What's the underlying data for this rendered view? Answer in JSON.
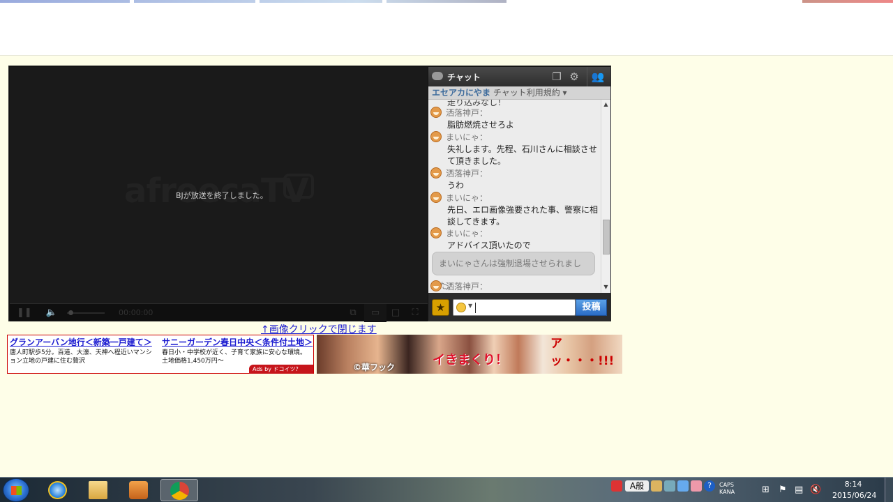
{
  "player": {
    "logo_text": "afreecaTV",
    "end_message": "BJが放送を終了しました。",
    "time": "00:00:00"
  },
  "chat": {
    "title": "チャット",
    "channel": "エセアカにやま",
    "terms": "チャット利用規約 ▾",
    "partial_top": "走り込みなし！",
    "messages": [
      {
        "nick": "洒落神戸：",
        "lines": [
          "脂肪燃焼させろよ"
        ]
      },
      {
        "nick": "まいにゃ：",
        "lines": [
          "失礼します。先程、石川さんに相談させ",
          "て頂きました。"
        ]
      },
      {
        "nick": "洒落神戸：",
        "lines": [
          "うわ"
        ]
      },
      {
        "nick": "まいにゃ：",
        "lines": [
          "先日、エロ画像強要された事、警察に相",
          "談してきます。"
        ]
      },
      {
        "nick": "まいにゃ：",
        "lines": [
          "アドバイス頂いたので"
        ]
      },
      {
        "nick": "洒落神戸：",
        "lines": []
      }
    ],
    "system_message": "まいにゃさんは強制退場させられました。",
    "post_button": "投稿"
  },
  "close_link": "↑画像クリックで閉じます",
  "ads": [
    {
      "title": "グランアーバン地行＜新築一戸建て＞",
      "desc": "唐人町駅歩5分。百道、大濠、天神へ程近いマンション立地の戸建に住む贅沢"
    },
    {
      "title": "サニーガーデン春日中央＜条件付土地＞",
      "desc": "春日小・中学校が近く、子育て家族に安心な環境。土地価格1,450万円～"
    }
  ],
  "ads_by": "Ads by ドコイツ？",
  "manga_text": {
    "credit": "©華フック",
    "shout": "イきまくり！",
    "top": "アッ・・・!!!"
  },
  "taskbar": {
    "ime": "A般",
    "caps": "CAPS",
    "kana": "KANA",
    "time": "8:14",
    "date": "2015/06/24"
  },
  "colors": {
    "page_bg": "#fefee8",
    "chat_channel": "#3d6b9c",
    "post_button": "#2a6cc4",
    "link": "#2222d0"
  }
}
